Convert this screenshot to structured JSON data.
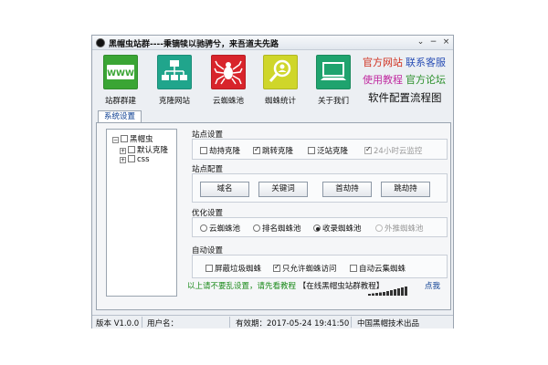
{
  "window": {
    "title": "黑帽虫站群----秉镝犊以驰骋兮，来吾道夫先路",
    "controls": {
      "dropdown": "⌄",
      "minimize": "−",
      "close": "×"
    }
  },
  "toolbar": {
    "items": [
      {
        "label": "站群群建",
        "icon": "www-icon",
        "icon_text": "WWW",
        "color": "#3aa534"
      },
      {
        "label": "克隆网站",
        "icon": "sitemap-icon",
        "color": "#20a58c"
      },
      {
        "label": "云蜘蛛池",
        "icon": "spider-icon",
        "color": "#d8242b"
      },
      {
        "label": "蜘蛛统计",
        "icon": "search-person-icon",
        "color": "#cfd62a"
      },
      {
        "label": "关于我们",
        "icon": "monitor-icon",
        "color": "#1fa36e"
      }
    ]
  },
  "links": {
    "official_site": "官方网站",
    "customer_service": "联系客服",
    "tutorial": "使用教程",
    "forum": "官方论坛",
    "config_flow": "软件配置流程图"
  },
  "tabs": [
    {
      "label": "系统设置"
    }
  ],
  "tree": {
    "root": {
      "label": "黑帽虫"
    },
    "children": [
      {
        "label": "默认克隆"
      },
      {
        "label": "css"
      }
    ]
  },
  "site_settings": {
    "title": "站点设置",
    "options": [
      {
        "label": "劫持克隆",
        "checked": false,
        "disabled": false
      },
      {
        "label": "跳转克隆",
        "checked": true,
        "disabled": false
      },
      {
        "label": "泛站克隆",
        "checked": false,
        "disabled": false
      },
      {
        "label": "24小时云监控",
        "checked": true,
        "disabled": true
      }
    ]
  },
  "site_config": {
    "title": "站点配置",
    "buttons": [
      "域名",
      "关键词",
      "首劫持",
      "跳劫持"
    ]
  },
  "optimize_settings": {
    "title": "优化设置",
    "options": [
      {
        "label": "云蜘蛛池",
        "selected": false,
        "disabled": false
      },
      {
        "label": "排名蜘蛛池",
        "selected": false,
        "disabled": false
      },
      {
        "label": "收录蜘蛛池",
        "selected": true,
        "disabled": false
      },
      {
        "label": "外推蜘蛛池",
        "selected": false,
        "disabled": true
      }
    ]
  },
  "auto_settings": {
    "title": "自动设置",
    "options": [
      {
        "label": "屏蔽垃圾蜘蛛",
        "checked": false
      },
      {
        "label": "只允许蜘蛛访问",
        "checked": true
      },
      {
        "label": "自动云集蜘蛛",
        "checked": false
      }
    ]
  },
  "notice": {
    "text": "以上请不要乱设置，请先看教程",
    "link": "【在线黑帽虫站群教程】",
    "click_me": "点我",
    "color": "#1a8a1a"
  },
  "status": {
    "version": "版本  V1.0.0",
    "user": "用户名：",
    "expiry": "有效期：2017-05-24 19:41:50",
    "company": "中国黑帽技术出品"
  }
}
